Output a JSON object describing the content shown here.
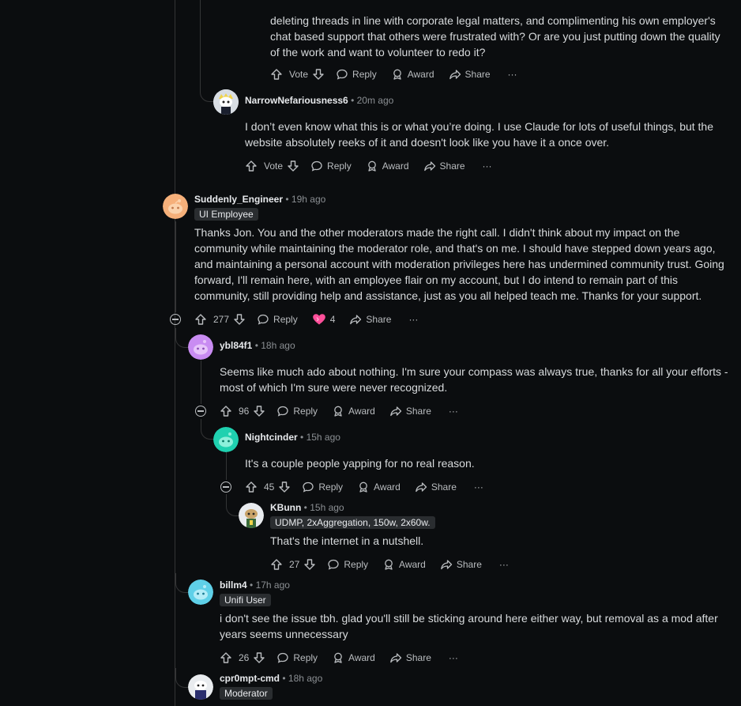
{
  "labels": {
    "vote": "Vote",
    "reply": "Reply",
    "award": "Award",
    "share": "Share",
    "more": "···"
  },
  "top_fragment": {
    "line1": "deleting threads in line with corporate legal matters, and complimenting his own employer's",
    "line2": "chat based support that others were frustrated with? Or are you just putting down the quality",
    "line3": "of the work and want to volunteer to redo it?"
  },
  "comments": [
    {
      "user": "NarrowNefariousness6",
      "time": "20m ago",
      "flair": "",
      "text": "I don’t even know what this is or what you’re doing. I use Claude for lots of useful things, but the website absolutely reeks of it and doesn't look like you have it a once over.",
      "score": "Vote"
    },
    {
      "user": "Suddenly_Engineer",
      "time": "19h ago",
      "flair": "UI Employee",
      "text": "Thanks Jon. You and the other moderators made the right call. I didn't think about my impact on the community while maintaining the moderator role, and that's on me. I should have stepped down years ago, and maintaining a personal account with moderation privileges here has undermined community trust. Going forward, I'll remain here, with an employee flair on my account, but I do intend to remain part of this community, still providing help and assistance, just as you all helped teach me. Thanks for your support.",
      "score": "277",
      "award_count": "4"
    },
    {
      "user": "ybl84f1",
      "time": "18h ago",
      "flair": "",
      "text": "Seems like much ado about nothing. I'm sure your compass was always true, thanks for all your efforts - most of which I'm sure were never recognized.",
      "score": "96"
    },
    {
      "user": "Nightcinder",
      "time": "15h ago",
      "flair": "",
      "text": "It's a couple people yapping for no real reason.",
      "score": "45"
    },
    {
      "user": "KBunn",
      "time": "15h ago",
      "flair": "UDMP, 2xAggregation, 150w, 2x60w.",
      "text": "That's the internet in a nutshell.",
      "score": "27"
    },
    {
      "user": "billm4",
      "time": "17h ago",
      "flair": "Unifi User",
      "text": "i don't see the issue tbh. glad you'll still be sticking around here either way, but removal as a mod after years seems unnecessary",
      "score": "26"
    },
    {
      "user": "cpr0mpt-cmd",
      "time": "18h ago",
      "flair": "Moderator",
      "text": "",
      "score": ""
    }
  ],
  "colors": {
    "bg": "#0b0d0f",
    "thread": "#343536",
    "award_pink": "#ff4f9a"
  }
}
